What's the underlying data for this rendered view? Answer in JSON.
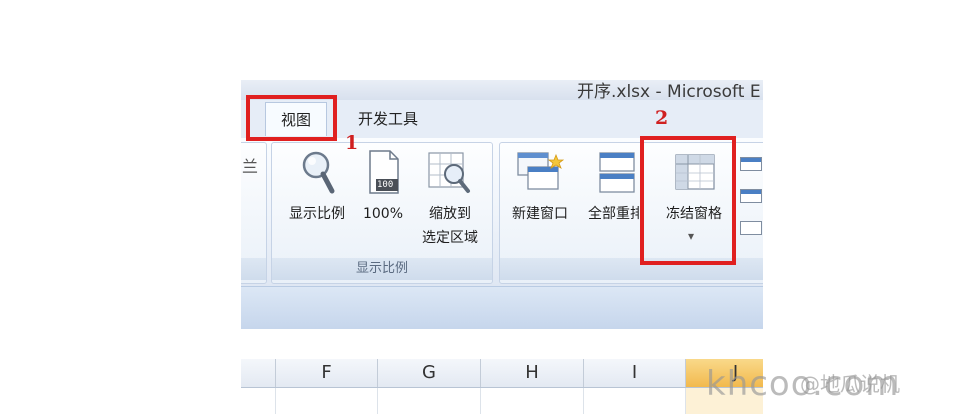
{
  "window": {
    "title_partial": "开序.xlsx - Microsoft E"
  },
  "tabs": {
    "view": "视图",
    "developer": "开发工具",
    "prev_edge": "兰"
  },
  "zoom_group": {
    "caption": "显示比例",
    "zoom_label": "显示比例",
    "zoom100_label": "100%",
    "zoom100_icon_text": "100",
    "zoom_selection_line1": "缩放到",
    "zoom_selection_line2": "选定区域"
  },
  "window_group": {
    "new_window": "新建窗口",
    "arrange_all": "全部重排",
    "freeze_panes": "冻结窗格",
    "freeze_dropdown": "▾"
  },
  "columns": [
    "F",
    "G",
    "H",
    "I",
    "J"
  ],
  "annotations": {
    "step1": "1",
    "step2": "2"
  },
  "watermark": {
    "site": "khcoo.com",
    "handle": "@地瓜说机"
  },
  "colors": {
    "highlight_red": "#e02020",
    "selected_column": "#f2b94d",
    "ribbon_blue": "#dfe7f3"
  }
}
